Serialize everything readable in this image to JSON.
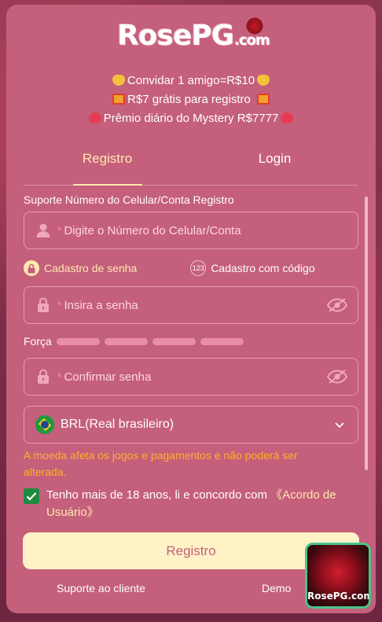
{
  "logo": {
    "text_rose": "Rose",
    "text_pg": "PG",
    "text_com": ".com"
  },
  "promos": [
    "Convidar 1 amigo=R$10",
    "R$7 grátis para registro",
    "Prêmio diário do Mystery R$7777"
  ],
  "tabs": {
    "register": "Registro",
    "login": "Login"
  },
  "form": {
    "account_label": "Suporte Número do Celular/Conta Registro",
    "account_placeholder": "Digite o Número do Celular/Conta",
    "required_mark": "*",
    "mode_password": "Cadastro de senha",
    "mode_code": "Cadastro com código",
    "mode_code_icon_text": "123",
    "password_placeholder": "Insira a senha",
    "strength_label": "Força",
    "confirm_placeholder": "Confirmar senha",
    "currency_value": "BRL(Real brasileiro)",
    "currency_warning": "A moeda afeta os jogos e pagamentos e não poderá ser alterada.",
    "agree_text": "Tenho mais de 18 anos, li e concordo com ",
    "agree_link": "《Acordo de Usuário》",
    "agree_checked": true
  },
  "submit_label": "Registro",
  "footer": {
    "support": "Suporte ao cliente",
    "demo": "Demo"
  },
  "float_badge_label": "RosePG.com",
  "colors": {
    "panel": "#c45f7c",
    "accent": "#ffe9b0",
    "warning": "#ffb12a",
    "checkbox": "#1f8a3f"
  }
}
